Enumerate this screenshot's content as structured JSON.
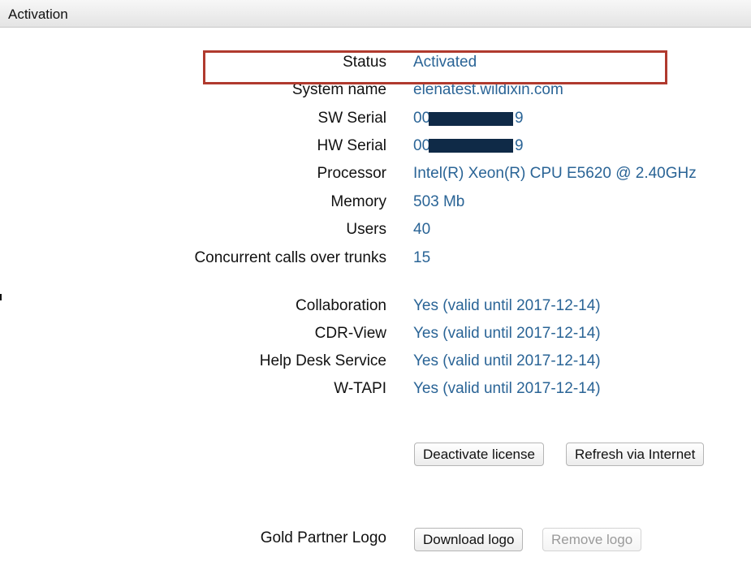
{
  "header": {
    "title": "Activation"
  },
  "info": [
    {
      "label": "Status",
      "value": "Activated"
    },
    {
      "label": "System name",
      "value": "elenatest.wildixin.com"
    },
    {
      "label": "SW Serial",
      "value": "00",
      "suffix": "9"
    },
    {
      "label": "HW Serial",
      "value": "00",
      "suffix": "9"
    },
    {
      "label": "Processor",
      "value": "Intel(R) Xeon(R) CPU E5620 @ 2.40GHz"
    },
    {
      "label": "Memory",
      "value": "503 Mb"
    },
    {
      "label": "Users",
      "value": "40"
    },
    {
      "label": "Concurrent calls over trunks",
      "value": "15"
    }
  ],
  "features": [
    {
      "label": "Collaboration",
      "value": "Yes (valid until 2017-12-14)"
    },
    {
      "label": "CDR-View",
      "value": "Yes (valid until 2017-12-14)"
    },
    {
      "label": "Help Desk Service",
      "value": "Yes (valid until 2017-12-14)"
    },
    {
      "label": "W-TAPI",
      "value": "Yes (valid until 2017-12-14)"
    }
  ],
  "actions": {
    "deactivate_label": "Deactivate license",
    "refresh_label": "Refresh via Internet"
  },
  "logo": {
    "label": "Gold Partner Logo",
    "download_label": "Download logo",
    "remove_label": "Remove logo"
  },
  "colors": {
    "value_text": "#2a6496",
    "highlight_border": "#b03a2e",
    "redaction": "#0f2a47"
  }
}
